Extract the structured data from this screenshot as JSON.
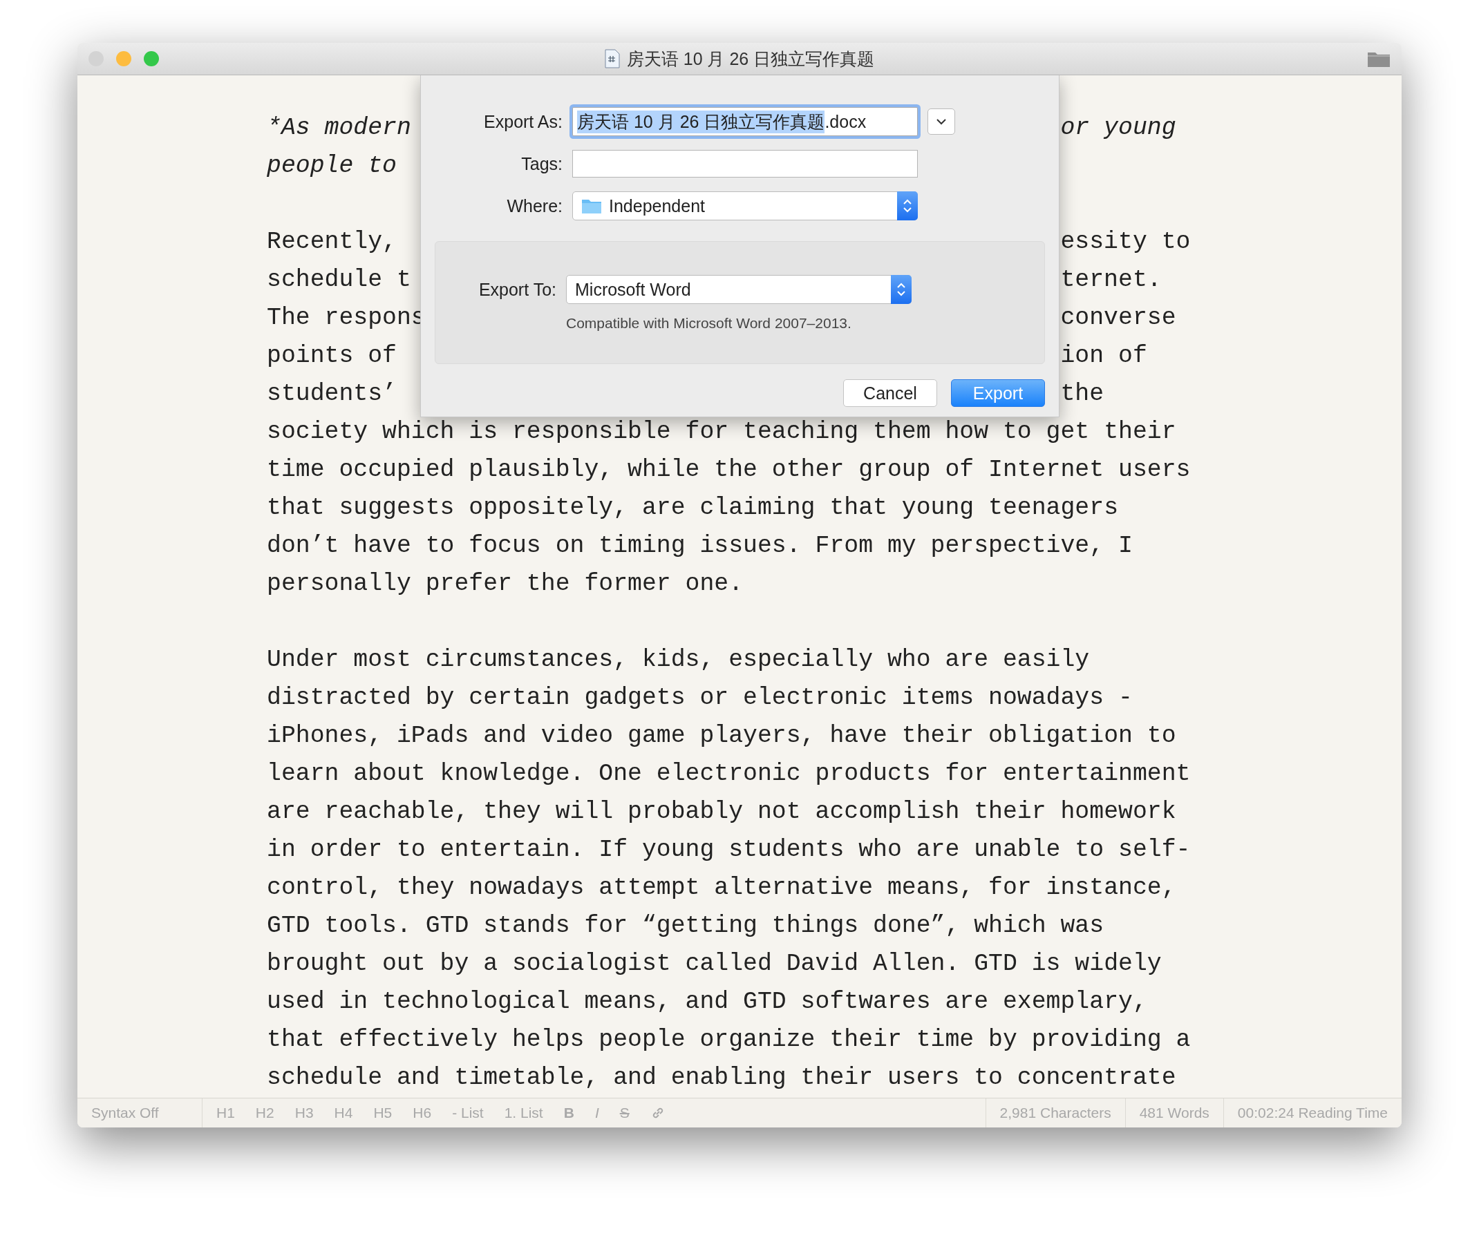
{
  "window": {
    "title": "房天语 10 月 26 日独立写作真题",
    "traffic_lights": [
      {
        "color": "#d3d3d3"
      },
      {
        "color": "#fdbc40"
      },
      {
        "color": "#34c84a"
      }
    ]
  },
  "document": {
    "paragraphs": [
      {
        "kind": "italic",
        "lines": [
          {
            "left": "*As modern",
            "right": "or young"
          },
          {
            "left": "people to"
          }
        ]
      },
      {
        "kind": "plain",
        "lines": [
          {
            "left": "Recently,",
            "right": "essity to"
          },
          {
            "left": "schedule t",
            "right": "ternet."
          },
          {
            "left": "The respons",
            "right": "converse"
          },
          {
            "left": "points of",
            "right": "ion of"
          },
          {
            "left": "students’",
            "right": "the"
          },
          {
            "left": "society which is responsible for teaching them how to get their"
          },
          {
            "left": "time occupied plausibly, while the other group of Internet users"
          },
          {
            "left": "that suggests oppositely, are claiming that young teenagers"
          },
          {
            "left": "don’t have to focus on timing issues. From my perspective, I"
          },
          {
            "left": "personally prefer the former one."
          }
        ]
      },
      {
        "kind": "plain",
        "lines": [
          {
            "left": "Under most circumstances, kids, especially who are easily"
          },
          {
            "left": "distracted by certain gadgets or electronic items nowadays -"
          },
          {
            "left": "iPhones, iPads and video game players, have their obligation to"
          },
          {
            "left": "learn about knowledge. One electronic products for entertainment"
          },
          {
            "left": "are reachable, they will probably not accomplish their homework"
          },
          {
            "left": "in order to entertain. If young students who are unable to self-"
          },
          {
            "left": "control, they nowadays attempt alternative means, for instance,"
          },
          {
            "left": "GTD tools. GTD stands for “getting things done”, which was"
          },
          {
            "left": "brought out by a socialogist called David Allen. GTD is widely"
          },
          {
            "left": "used in technological means, and GTD softwares are exemplary,"
          },
          {
            "left": "that effectively helps people organize their time by providing a"
          },
          {
            "left": "schedule and timetable, and enabling their users to concentrate"
          }
        ]
      }
    ]
  },
  "export_sheet": {
    "export_as_label": "Export As:",
    "filename_parts": [
      {
        "text": "房天语 10 月 26 日独立写作真题",
        "selected": true
      },
      {
        "text": ".docx",
        "selected": false
      }
    ],
    "tags_label": "Tags:",
    "where_label": "Where:",
    "where_value": "Independent",
    "export_to_label": "Export To:",
    "export_to_value": "Microsoft Word",
    "note": "Compatible with Microsoft Word 2007–2013.",
    "buttons": [
      {
        "label": "Cancel",
        "kind": "normal"
      },
      {
        "label": "Export",
        "kind": "default"
      }
    ]
  },
  "status_bar": {
    "syntax": "Syntax Off",
    "tools": [
      {
        "label": "H1",
        "kind": "text"
      },
      {
        "label": "H2",
        "kind": "text"
      },
      {
        "label": "H3",
        "kind": "text"
      },
      {
        "label": "H4",
        "kind": "text"
      },
      {
        "label": "H5",
        "kind": "text"
      },
      {
        "label": "H6",
        "kind": "text"
      },
      {
        "label": "- List",
        "kind": "text"
      },
      {
        "label": "1. List",
        "kind": "text"
      },
      {
        "label": "B",
        "kind": "bold"
      },
      {
        "label": "I",
        "kind": "italic"
      },
      {
        "label": "S",
        "kind": "strike"
      },
      {
        "kind": "link"
      }
    ],
    "stats": [
      "2,981 Characters",
      "481 Words",
      "00:02:24 Reading Time"
    ]
  }
}
